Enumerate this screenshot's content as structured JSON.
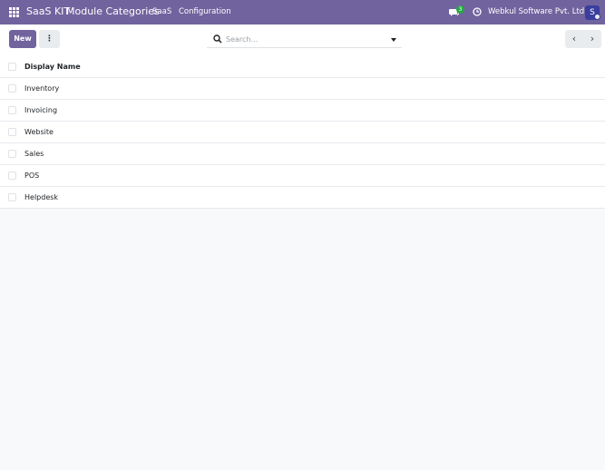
{
  "navbar": {
    "brand": "SaaS KIT",
    "section": "Module Categories",
    "menus": [
      "SaaS",
      "Configuration"
    ],
    "chat_badge": "3",
    "company": "Webkul Software Pvt. Ltd.",
    "avatar_initial": "S",
    "color": "#71639e"
  },
  "control_panel": {
    "new_label": "New",
    "gear_label": "⋮",
    "search_placeholder": "Search...",
    "pager_prev": "‹",
    "pager_next": "›"
  },
  "list": {
    "column_header": "Display Name",
    "rows": [
      "Inventory",
      "Invoicing",
      "Website",
      "Sales",
      "POS",
      "Helpdesk"
    ]
  }
}
